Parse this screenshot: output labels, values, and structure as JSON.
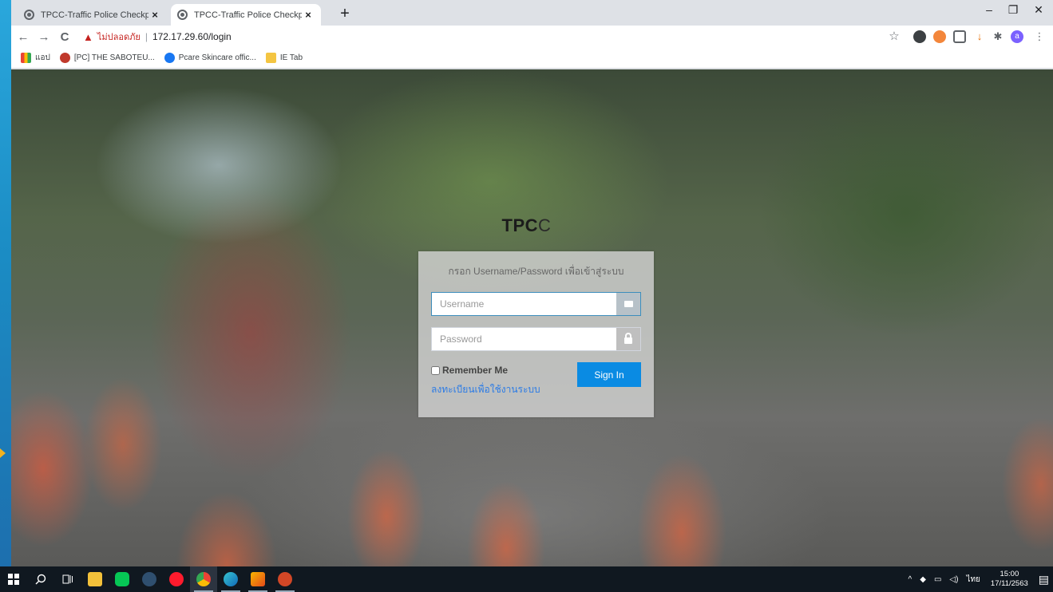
{
  "browser": {
    "tabs": [
      {
        "title": "TPCC-Traffic Police Checkpoint C",
        "close": "×"
      },
      {
        "title": "TPCC-Traffic Police Checkpoint C",
        "close": "×"
      }
    ],
    "new_tab": "+",
    "window_controls": {
      "minimize": "–",
      "restore": "❐",
      "close": "✕"
    },
    "nav": {
      "back": "←",
      "forward": "→",
      "reload": "C"
    },
    "address": {
      "warning_icon": "▲",
      "insecure_label": "ไม่ปลอดภัย",
      "separator": "|",
      "url": "172.17.29.60/login"
    },
    "bookmarks": [
      {
        "label": "แอป",
        "icon": "apps-icon"
      },
      {
        "label": "[PC] THE SABOTEU...",
        "icon": "game-icon"
      },
      {
        "label": "Pcare Skincare offic...",
        "icon": "facebook-icon"
      },
      {
        "label": "IE Tab",
        "icon": "folder-icon"
      }
    ],
    "extension_letter": "a"
  },
  "page": {
    "brand_bold": "TPC",
    "brand_light": "C",
    "login_message": "กรอก Username/Password เพื่อเข้าสู่ระบบ",
    "username_placeholder": "Username",
    "password_placeholder": "Password",
    "remember_label": "Remember Me",
    "signin_label": "Sign In",
    "register_link": "ลงทะเบียนเพื่อใช้งานระบบ"
  },
  "taskbar": {
    "tray_lang": "ไทย",
    "time": "15:00",
    "date": "17/11/2563"
  },
  "colors": {
    "signin_button": "#0a8be3",
    "link": "#2c7be5",
    "insecure": "#c5221f"
  }
}
